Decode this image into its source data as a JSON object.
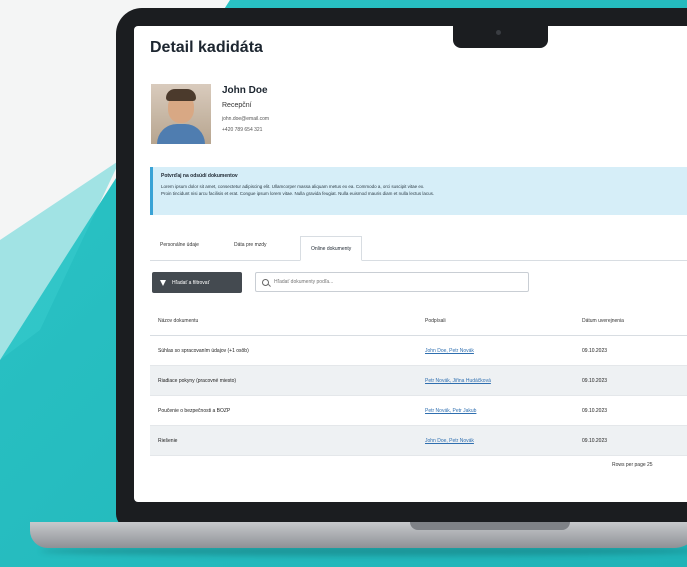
{
  "page": {
    "title": "Detail kadidáta"
  },
  "candidate": {
    "name": "John Doe",
    "role": "Recepční",
    "email": "john.doe@email.com",
    "phone": "+420 789 654 321"
  },
  "info": {
    "title": "Potvrďaj na odsúdí dokumentov",
    "line1": "Lorem ipsum dolor sit amet, consectetur adipiscing elit. Ullamcorper massa aliquam metus ex ea. Commodo a, orci suscipit vitae ex.",
    "line2": "Proin tincidunt nisi arcu facilisis et erat. Congue ipsum lorem vitae. Nulla gravida feugiat. Nulla euismod mauris diam et nulla lectus lacus."
  },
  "tabs": [
    {
      "label": "Personálne údaje"
    },
    {
      "label": "Dáta pre mzdy"
    },
    {
      "label": "Online dokumenty"
    }
  ],
  "toolbar": {
    "filter_label": "Hľadať a filtrovať",
    "search_placeholder": "Hľadať dokumenty podľa..."
  },
  "table": {
    "headers": [
      "Názov dokumentu",
      "Podpísali",
      "Dátum uverejnenia"
    ],
    "rows": [
      {
        "name": "Súhlas so spracovaním údajov (+1 osôb)",
        "signed": "John Doe, Petr Novák",
        "date": "09.10.2023"
      },
      {
        "name": "Riadiace pokyny (pracovné miesto)",
        "signed": "Petr Novák, Jiřina Hudáčková",
        "date": "09.10.2023"
      },
      {
        "name": "Poučenie o bezpečnosti a BOZP",
        "signed": "Petr Novák, Petr Jakub",
        "date": "09.10.2023"
      },
      {
        "name": "Riešenie",
        "signed": "John Doe, Petr Novák",
        "date": "09.10.2023"
      }
    ]
  },
  "pager": {
    "label": "Rows per page",
    "value": "25"
  }
}
